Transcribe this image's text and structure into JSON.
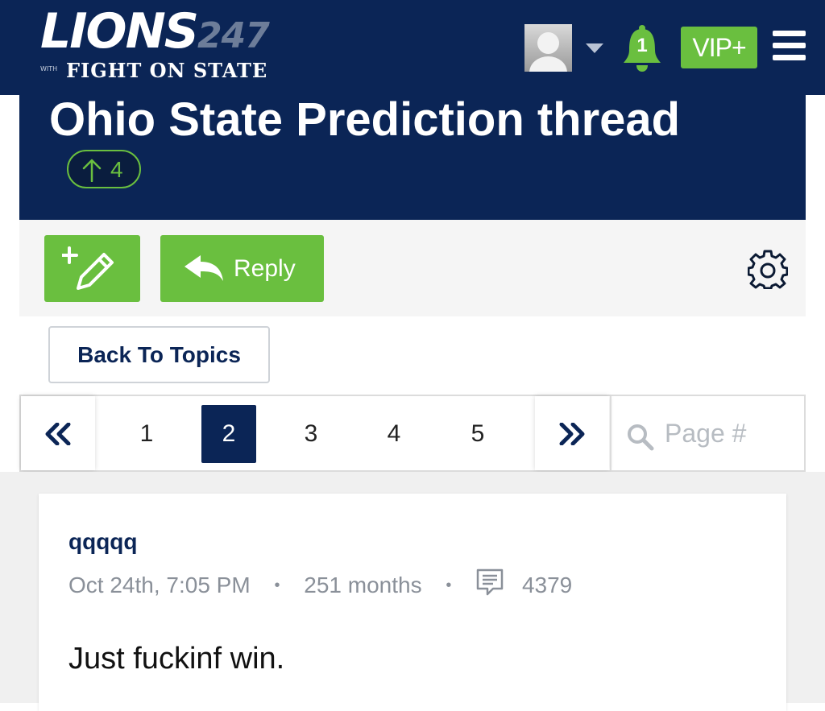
{
  "header": {
    "logo_main": "LIONS",
    "logo_number": "247",
    "logo_with": "WITH",
    "logo_sub": "FIGHT ON STATE",
    "notification_count": "1",
    "vip_label": "VIP+"
  },
  "thread": {
    "title": "Ohio State Prediction thread",
    "upvotes": "4"
  },
  "toolbar": {
    "reply_label": "Reply"
  },
  "navigation": {
    "back_label": "Back To Topics"
  },
  "pagination": {
    "pages": [
      "1",
      "2",
      "3",
      "4",
      "5"
    ],
    "current_page": "2",
    "search_placeholder": "Page #"
  },
  "post": {
    "author": "qqqqq",
    "timestamp": "Oct 24th, 7:05 PM",
    "tenure": "251 months",
    "post_count": "4379",
    "body": "Just fuckinf win."
  },
  "colors": {
    "navy": "#0b2556",
    "green": "#6abf3f",
    "muted_text": "#8a9099"
  },
  "icons": [
    "caret-down-icon",
    "bell-icon",
    "hamburger-menu-icon",
    "new-topic-pencil-icon",
    "reply-arrow-icon",
    "gear-icon",
    "double-chevron-left-icon",
    "double-chevron-right-icon",
    "search-icon",
    "comment-icon",
    "upvote-arrow-icon"
  ]
}
